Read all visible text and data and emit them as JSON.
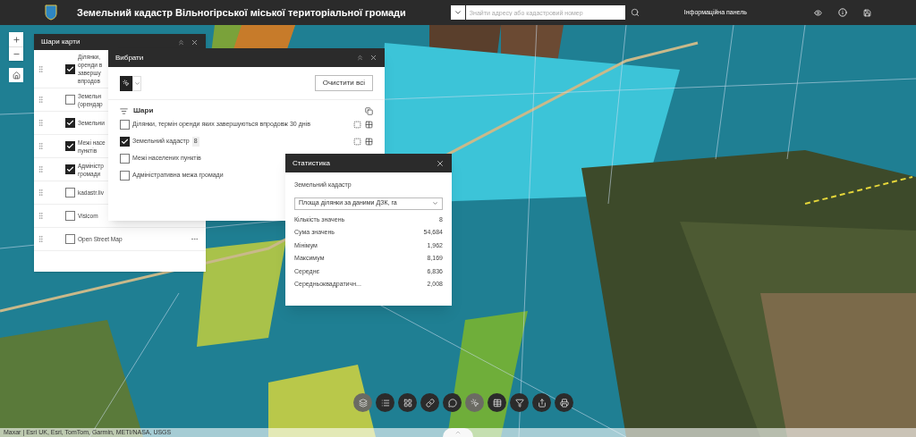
{
  "header": {
    "title": "Земельний кадастр Вільногірської міської територіальної громади",
    "search_placeholder": "Знайти адресу або кадастровий номер",
    "info_panel": "Інформаційна панель"
  },
  "layers_panel": {
    "title": "Шари карти",
    "layers": [
      {
        "lines": [
          "Ділянки,",
          "оренди в",
          "завершу",
          "впродов"
        ],
        "checked": true
      },
      {
        "lines": [
          "Земельн",
          "(орендар"
        ],
        "checked": false
      },
      {
        "lines": [
          "Земельни"
        ],
        "checked": true
      },
      {
        "lines": [
          "Межі насе",
          "пунктів"
        ],
        "checked": true
      },
      {
        "lines": [
          "Адміністр",
          "громади"
        ],
        "checked": true
      },
      {
        "lines": [
          "kadastr.liv"
        ],
        "checked": false
      },
      {
        "lines": [
          "Visicom"
        ],
        "checked": false
      },
      {
        "lines": [
          "Open Street Map"
        ],
        "checked": false
      }
    ]
  },
  "select_panel": {
    "title": "Вибрати",
    "clear_button": "Очистити всі",
    "layers_heading": "Шари",
    "layers": [
      {
        "label": "Ділянки, термін оренди яких завершуються впродовж 30 днів",
        "checked": false
      },
      {
        "label": "Земельний кадастр",
        "count": "8",
        "checked": true
      },
      {
        "label": "Межі населених пунктів",
        "checked": false
      },
      {
        "label": "Адміністративна межа громади",
        "checked": false
      }
    ]
  },
  "stats_panel": {
    "title": "Статистика",
    "layer": "Земельний кадастр",
    "field": "Площа ділянки за даними ДЗК, га",
    "rows": [
      {
        "label": "Кількість значень",
        "value": "8"
      },
      {
        "label": "Сума значень",
        "value": "54,684"
      },
      {
        "label": "Мінімум",
        "value": "1,962"
      },
      {
        "label": "Максимум",
        "value": "8,169"
      },
      {
        "label": "Середнє",
        "value": "6,836"
      },
      {
        "label": "Середньоквадратичн...",
        "value": "2,008"
      }
    ]
  },
  "toolbar": [
    {
      "selected": true
    },
    {
      "selected": false
    },
    {
      "selected": false
    },
    {
      "selected": false
    },
    {
      "selected": false
    },
    {
      "selected": true
    },
    {
      "selected": false
    },
    {
      "selected": false
    },
    {
      "selected": false
    },
    {
      "selected": false
    }
  ],
  "attribution": "Maxar | Esri UK, Esri, TomTom, Garmin, METI/NASA, USGS"
}
